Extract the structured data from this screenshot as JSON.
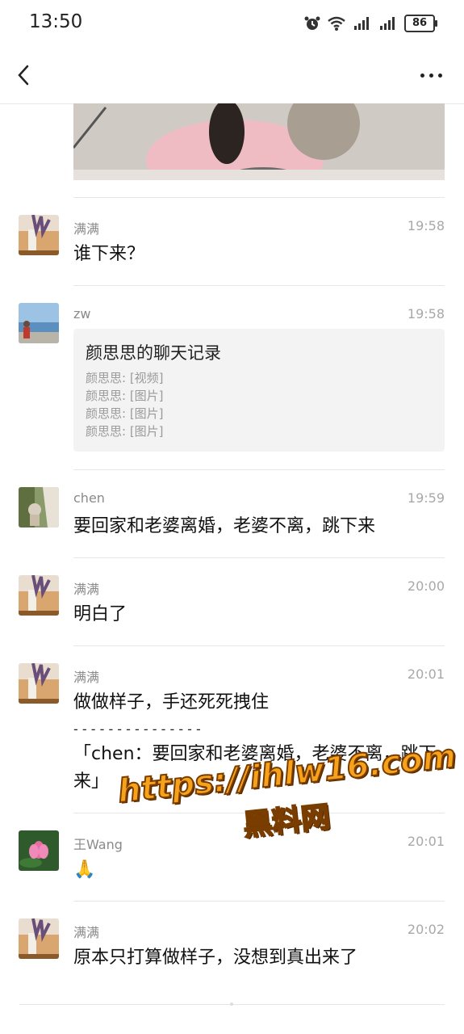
{
  "status_bar": {
    "time": "13:50",
    "battery": "86"
  },
  "nav": {
    "back_icon": "chevron-left-icon",
    "more_icon": "more-dots-icon"
  },
  "messages": [
    {
      "sender": "满满",
      "time": "19:58",
      "text": "谁下来？"
    },
    {
      "sender": "zw",
      "time": "19:58",
      "record": {
        "title": "颜思思的聊天记录",
        "lines": [
          "颜思思: [视频]",
          "颜思思: [图片]",
          "颜思思: [图片]",
          "颜思思: [图片]"
        ]
      }
    },
    {
      "sender": "chen",
      "time": "19:59",
      "text": "要回家和老婆离婚，老婆不离，跳下来"
    },
    {
      "sender": "满满",
      "time": "20:00",
      "text": "明白了"
    },
    {
      "sender": "满满",
      "time": "20:01",
      "text": "做做样子，手还死死拽住",
      "separator": "- - - - - - - - - - - - - - -",
      "quote": "「chen：要回家和老婆离婚，老婆不离，跳下来」"
    },
    {
      "sender": "王Wang",
      "time": "20:01",
      "text": "🙏"
    },
    {
      "sender": "满满",
      "time": "20:02",
      "text": "原本只打算做样子，没想到真出来了"
    }
  ],
  "watermark": {
    "url": "https://ihlw16.com",
    "name": "黑料网"
  }
}
